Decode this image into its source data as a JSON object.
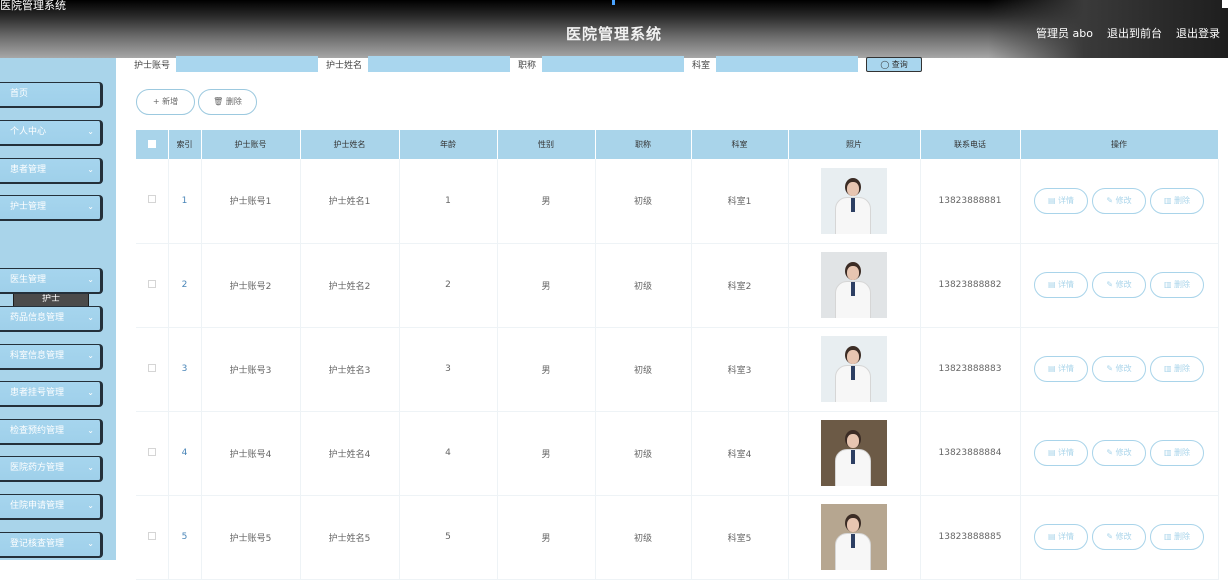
{
  "header": {
    "corner_title": "医院管理系统",
    "brand": "医院管理系统",
    "admin": "管理员 abo",
    "exit_front": "退出到前台",
    "logout": "退出登录"
  },
  "sidebar": {
    "items": [
      {
        "label": "首页",
        "has_chevron": false
      },
      {
        "label": "个人中心",
        "has_chevron": true
      },
      {
        "label": "患者管理",
        "has_chevron": true
      },
      {
        "label": "护士管理",
        "has_chevron": true
      },
      {
        "label": "医生管理",
        "has_chevron": true
      },
      {
        "label": "药品信息管理",
        "has_chevron": true
      },
      {
        "label": "科室信息管理",
        "has_chevron": true
      },
      {
        "label": "患者挂号管理",
        "has_chevron": true
      },
      {
        "label": "检查预约管理",
        "has_chevron": true
      },
      {
        "label": "医院药方管理",
        "has_chevron": true
      },
      {
        "label": "住院申请管理",
        "has_chevron": true
      },
      {
        "label": "登记核查管理",
        "has_chevron": true
      }
    ],
    "sub_item": "护士"
  },
  "search": {
    "nurse_account_label": "护士账号",
    "nurse_name_label": "护士姓名",
    "title_label": "职称",
    "dept_label": "科室",
    "query_button": "◯ 查询"
  },
  "actions": {
    "add": "+ 新增",
    "delete": "🗑 删除"
  },
  "table": {
    "headers": [
      "索引",
      "护士账号",
      "护士姓名",
      "年龄",
      "性别",
      "职称",
      "科室",
      "照片",
      "联系电话",
      "操作"
    ],
    "rows": [
      {
        "index": "1",
        "account": "护士账号1",
        "name": "护士姓名1",
        "age": "1",
        "gender": "男",
        "title": "初级",
        "dept": "科室1",
        "phone": "13823888881"
      },
      {
        "index": "2",
        "account": "护士账号2",
        "name": "护士姓名2",
        "age": "2",
        "gender": "男",
        "title": "初级",
        "dept": "科室2",
        "phone": "13823888882"
      },
      {
        "index": "3",
        "account": "护士账号3",
        "name": "护士姓名3",
        "age": "3",
        "gender": "男",
        "title": "初级",
        "dept": "科室3",
        "phone": "13823888883"
      },
      {
        "index": "4",
        "account": "护士账号4",
        "name": "护士姓名4",
        "age": "4",
        "gender": "男",
        "title": "初级",
        "dept": "科室4",
        "phone": "13823888884"
      },
      {
        "index": "5",
        "account": "护士账号5",
        "name": "护士姓名5",
        "age": "5",
        "gender": "男",
        "title": "初级",
        "dept": "科室5",
        "phone": "13823888885"
      }
    ],
    "op_labels": {
      "detail": "详情",
      "edit": "修改",
      "delete": "删除"
    }
  },
  "colors": {
    "accent": "#a9d4ea",
    "header_dark": "#2a2a2a",
    "sub_item_bg": "#4b4b4b"
  },
  "icons": {
    "detail": "document-icon",
    "edit": "pencil-icon",
    "delete": "trash-icon",
    "search": "search-icon"
  }
}
